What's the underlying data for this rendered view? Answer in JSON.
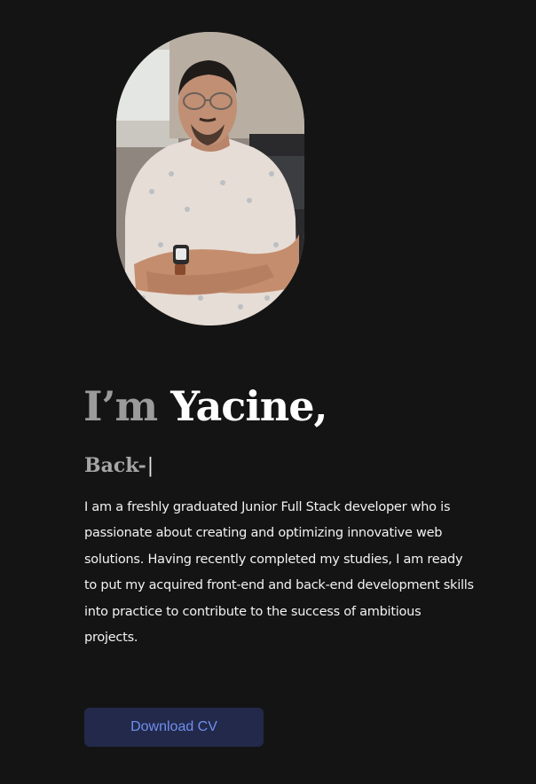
{
  "hero": {
    "title_prefix": "I’m ",
    "title_name": "Yacine,",
    "role_typed": "Back-",
    "role_cursor": "|",
    "bio": "I am a freshly graduated Junior Full Stack developer who is passionate about creating and optimizing innovative web solutions. Having recently completed my studies, I am ready to put my acquired front-end and back-end development skills into practice to contribute to the success of ambitious projects."
  },
  "actions": {
    "download_label": "Download CV"
  },
  "colors": {
    "background": "#141414",
    "title_muted": "#9b9b9b",
    "button_bg": "#23294a",
    "button_text": "#6d8ff0"
  }
}
